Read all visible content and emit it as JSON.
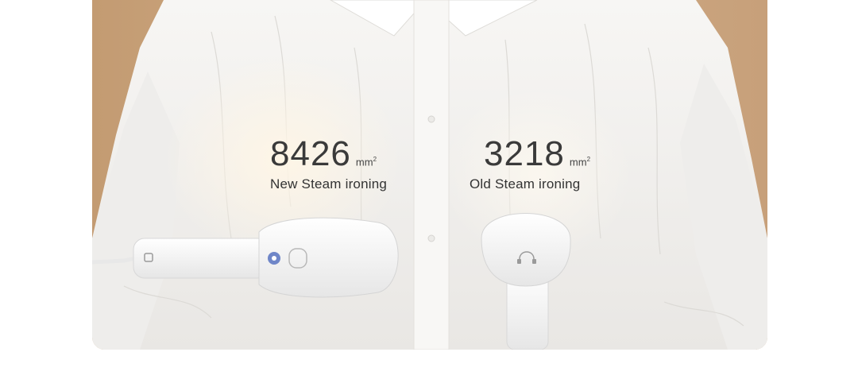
{
  "stats": {
    "new": {
      "value": "8426",
      "unit": "mm",
      "unit_exp": "2",
      "label": "New Steam ironing"
    },
    "old": {
      "value": "3218",
      "unit": "mm",
      "unit_exp": "2",
      "label": "Old Steam ironing"
    }
  },
  "colors": {
    "background": "#ffffff",
    "wood": "#c9a27a",
    "shirt": "#f4f3f1",
    "text": "#3a3a3a",
    "device": "#f7f7f7",
    "indicator": "#6f86c8"
  }
}
